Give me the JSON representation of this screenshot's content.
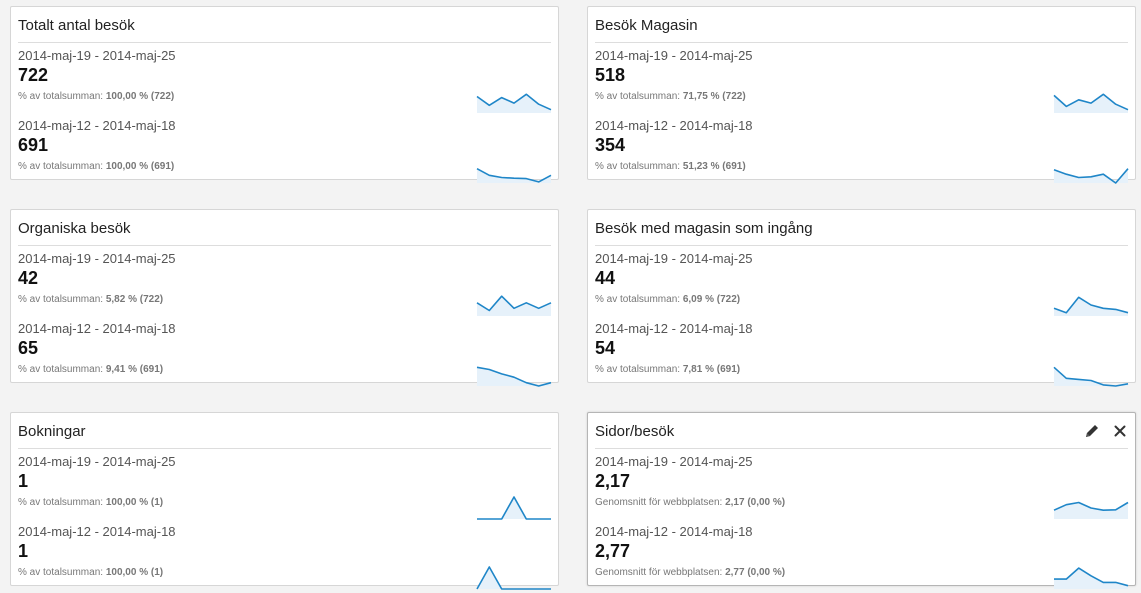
{
  "widgets": [
    {
      "title": "Totalt antal besök",
      "rows": [
        {
          "range": "2014-maj-19 - 2014-maj-25",
          "value": "722",
          "pct_label": "% av totalsumman:",
          "pct_value": "100,00 % (722)",
          "spark": [
            0.75,
            0.35,
            0.7,
            0.45,
            0.85,
            0.4,
            0.15
          ]
        },
        {
          "range": "2014-maj-12 - 2014-maj-18",
          "value": "691",
          "pct_label": "% av totalsumman:",
          "pct_value": "100,00 % (691)",
          "spark": [
            0.65,
            0.35,
            0.25,
            0.22,
            0.2,
            0.05,
            0.35
          ]
        }
      ]
    },
    {
      "title": "Besök Magasin",
      "rows": [
        {
          "range": "2014-maj-19 - 2014-maj-25",
          "value": "518",
          "pct_label": "% av totalsumman:",
          "pct_value": "71,75 % (722)",
          "spark": [
            0.8,
            0.3,
            0.6,
            0.45,
            0.85,
            0.4,
            0.15
          ]
        },
        {
          "range": "2014-maj-12 - 2014-maj-18",
          "value": "354",
          "pct_label": "% av totalsumman:",
          "pct_value": "51,23 % (691)",
          "spark": [
            0.6,
            0.4,
            0.25,
            0.28,
            0.4,
            0.0,
            0.65
          ]
        }
      ]
    },
    {
      "title": "Organiska besök",
      "rows": [
        {
          "range": "2014-maj-19 - 2014-maj-25",
          "value": "42",
          "pct_label": "% av totalsumman:",
          "pct_value": "5,82 % (722)",
          "spark": [
            0.6,
            0.25,
            0.9,
            0.35,
            0.6,
            0.35,
            0.6
          ]
        },
        {
          "range": "2014-maj-12 - 2014-maj-18",
          "value": "65",
          "pct_label": "% av totalsumman:",
          "pct_value": "9,41 % (691)",
          "spark": [
            0.85,
            0.75,
            0.55,
            0.4,
            0.15,
            0.0,
            0.15
          ]
        }
      ]
    },
    {
      "title": "Besök med magasin som ingång",
      "rows": [
        {
          "range": "2014-maj-19 - 2014-maj-25",
          "value": "44",
          "pct_label": "% av totalsumman:",
          "pct_value": "6,09 % (722)",
          "spark": [
            0.35,
            0.15,
            0.85,
            0.5,
            0.35,
            0.3,
            0.15
          ]
        },
        {
          "range": "2014-maj-12 - 2014-maj-18",
          "value": "54",
          "pct_label": "% av totalsumman:",
          "pct_value": "7,81 % (691)",
          "spark": [
            0.85,
            0.35,
            0.3,
            0.25,
            0.05,
            0.0,
            0.1
          ]
        }
      ]
    },
    {
      "title": "Bokningar",
      "rows": [
        {
          "range": "2014-maj-19 - 2014-maj-25",
          "value": "1",
          "pct_label": "% av totalsumman:",
          "pct_value": "100,00 % (1)",
          "spark": [
            0,
            0,
            0,
            1,
            0,
            0,
            0
          ]
        },
        {
          "range": "2014-maj-12 - 2014-maj-18",
          "value": "1",
          "pct_label": "% av totalsumman:",
          "pct_value": "100,00 % (1)",
          "spark": [
            0,
            1,
            0,
            0,
            0,
            0,
            0
          ]
        }
      ]
    },
    {
      "title": "Sidor/besök",
      "active": true,
      "rows": [
        {
          "range": "2014-maj-19 - 2014-maj-25",
          "value": "2,17",
          "pct_label": "Genomsnitt för webbplatsen:",
          "pct_value": "2,17 (0,00 %)",
          "spark": [
            0.4,
            0.65,
            0.75,
            0.5,
            0.4,
            0.42,
            0.75
          ]
        },
        {
          "range": "2014-maj-12 - 2014-maj-18",
          "value": "2,77",
          "pct_label": "Genomsnitt för webbplatsen:",
          "pct_value": "2,77 (0,00 %)",
          "spark": [
            0.45,
            0.45,
            0.95,
            0.6,
            0.3,
            0.3,
            0.15
          ]
        }
      ]
    }
  ],
  "icons": {
    "edit": "pencil-icon",
    "close": "close-icon"
  },
  "colors": {
    "spark_line": "#1f86c8",
    "spark_fill": "#e6f1fa",
    "page_bg": "#f3f3f3"
  }
}
